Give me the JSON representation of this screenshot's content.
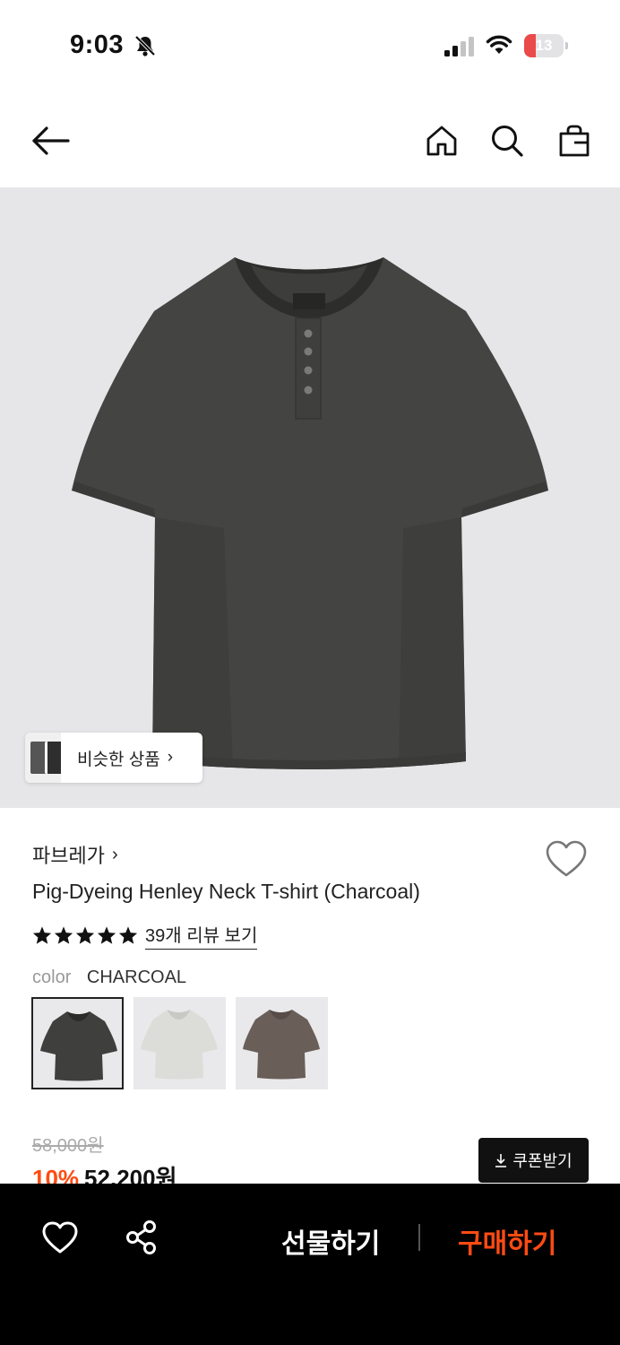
{
  "status_bar": {
    "time": "9:03",
    "battery": "13",
    "icons": [
      "bell-off-icon",
      "signal-icon",
      "wifi-icon",
      "battery-icon"
    ]
  },
  "nav": {
    "icons": [
      "back-arrow-icon",
      "home-icon",
      "search-icon",
      "shopping-bag-icon"
    ]
  },
  "image": {
    "similar_label": "비슷한 상품",
    "similar_chevron": "›"
  },
  "product": {
    "brand": "파브레가",
    "brand_chevron": "›",
    "title": "Pig-Dyeing Henley Neck T-shirt (Charcoal)",
    "rating_stars": 5,
    "review_link": "39개 리뷰 보기",
    "color_key": "color",
    "color_value": "CHARCOAL",
    "swatches": [
      {
        "name": "charcoal",
        "color": "#3f3f3e",
        "selected": true
      },
      {
        "name": "ivory",
        "color": "#dcdcd8",
        "selected": false
      },
      {
        "name": "brown",
        "color": "#6a5e59",
        "selected": false
      }
    ],
    "original_price": "58,000원",
    "discount": "10%",
    "sale_price": "52,200원"
  },
  "coupon": {
    "label": "쿠폰받기"
  },
  "bottom_bar": {
    "gift_label": "선물하기",
    "buy_label": "구매하기"
  },
  "colors": {
    "accent": "#ff4b13",
    "dark": "#111111",
    "image_bg": "#e6e6e8"
  }
}
